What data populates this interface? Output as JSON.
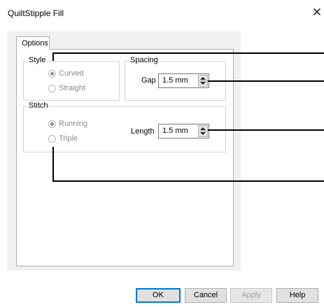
{
  "window": {
    "title": "QuiltStipple Fill",
    "close_glyph": "✕"
  },
  "tabs": [
    {
      "label": "Options",
      "selected": true
    }
  ],
  "style_group": {
    "label": "Style",
    "options": [
      {
        "label": "Curved",
        "checked": true,
        "enabled": false
      },
      {
        "label": "Straight",
        "checked": false,
        "enabled": false
      }
    ]
  },
  "spacing_group": {
    "label": "Spacing",
    "gap_label": "Gap",
    "gap_value": "1.5 mm"
  },
  "stitch_group": {
    "label": "Stitch",
    "options": [
      {
        "label": "Running",
        "checked": true,
        "enabled": false
      },
      {
        "label": "Triple",
        "checked": false,
        "enabled": false
      }
    ],
    "length_label": "Length",
    "length_value": "1.5 mm"
  },
  "buttons": {
    "ok": "OK",
    "cancel": "Cancel",
    "apply": "Apply",
    "help": "Help"
  },
  "colors": {
    "default_button_border": "#0078d7",
    "dialog_background": "#f0f0f0",
    "disabled_text": "#8a8a8a"
  }
}
